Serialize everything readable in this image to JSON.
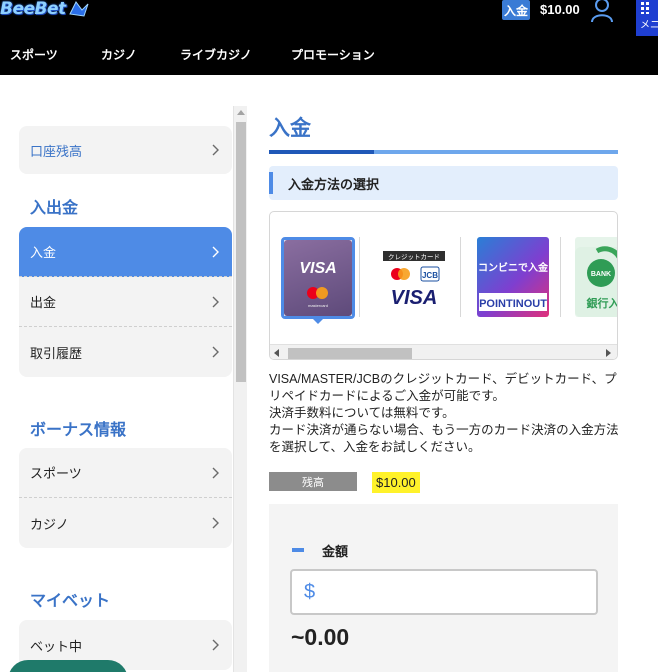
{
  "header": {
    "logo_text": "BeeBet",
    "deposit_chip": "入金",
    "balance": "$10.00",
    "menu_label": "メニュー"
  },
  "nav": [
    "スポーツ",
    "カジノ",
    "ライブカジノ",
    "プロモーション"
  ],
  "sidebar": {
    "account_balance": "口座残高",
    "deposit_withdraw_title": "入出金",
    "deposit_withdraw_items": [
      "入金",
      "出金",
      "取引履歴"
    ],
    "bonus_title": "ボーナス情報",
    "bonus_items": [
      "スポーツ",
      "カジノ"
    ],
    "mybet_title": "マイベット",
    "mybet_items": [
      "ベット中"
    ]
  },
  "main": {
    "title": "入金",
    "method_section": "入金方法の選択",
    "methods": [
      {
        "name": "VISA",
        "sub": "mastercard",
        "selected": true
      },
      {
        "name": "VISA",
        "top": "クレジットカード",
        "sub": "JCB"
      },
      {
        "name": "コンビニで入金",
        "sub": "POINTINOUT"
      },
      {
        "name": "銀行入",
        "top": "BANK"
      }
    ],
    "description": [
      "VISA/MASTER/JCBのクレジットカード、デビットカード、プリペイドカードによるご入金が可能です。",
      "決済手数料については無料です。",
      "カード決済が通らない場合、もう一方のカード決済の入金方法を選択して、入金をお試しください。"
    ],
    "balance_label": "残高",
    "balance_value": "$10.00",
    "amount_label": "金額",
    "currency_symbol": "$",
    "amount_placeholder": "",
    "approx_amount": "~0.00"
  },
  "colors": {
    "accent": "#4e8be6",
    "title_blue": "#3a73c7",
    "highlight": "#fff22a"
  }
}
